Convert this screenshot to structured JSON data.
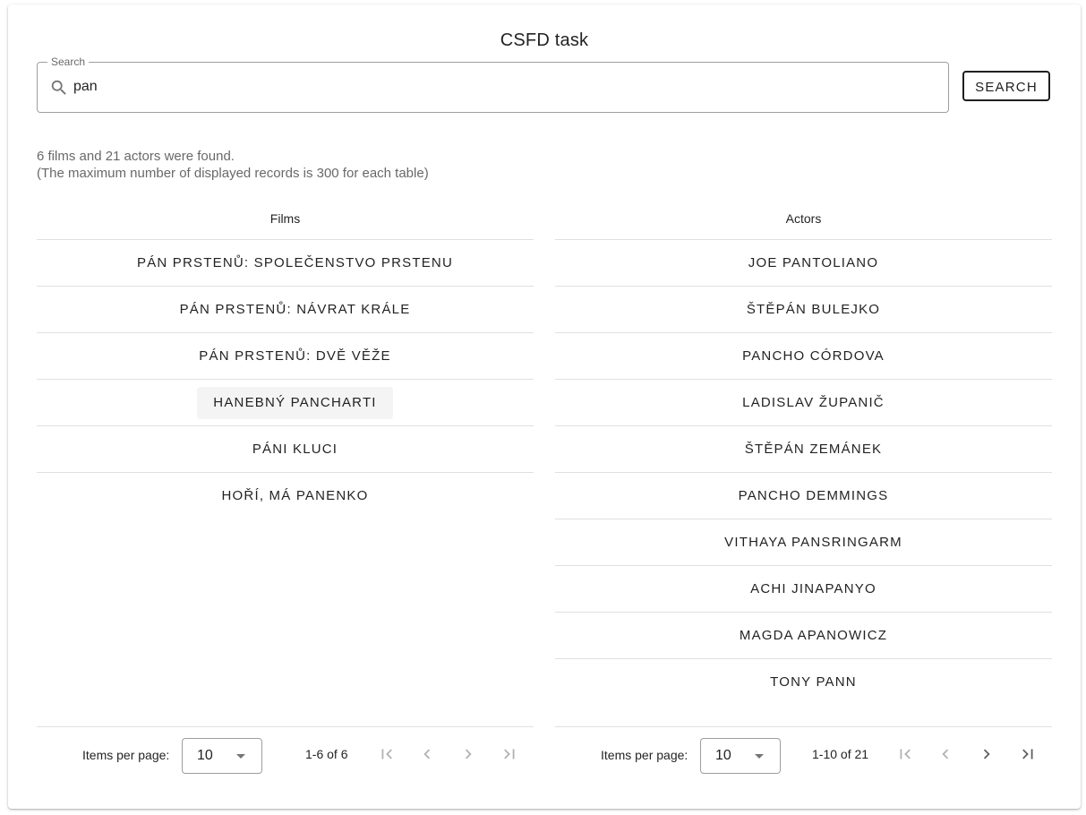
{
  "app": {
    "title": "CSFD task"
  },
  "search": {
    "legend": "Search",
    "value": "pan",
    "button_label": "SEARCH"
  },
  "result_info": {
    "line1": "6 films and 21 actors were found.",
    "line2": "(The maximum number of displayed records is 300 for each table)"
  },
  "films": {
    "header": "Films",
    "rows": [
      "PÁN PRSTENŮ: SPOLEČENSTVO PRSTENU",
      "PÁN PRSTENŮ: NÁVRAT KRÁLE",
      "PÁN PRSTENŮ: DVĚ VĚŽE",
      "HANEBNÝ PANCHARTI",
      "PÁNI KLUCI",
      "HOŘÍ, MÁ PANENKO"
    ],
    "paginator": {
      "items_per_page_label": "Items per page:",
      "page_size": "10",
      "range": "1-6 of 6"
    }
  },
  "actors": {
    "header": "Actors",
    "rows": [
      "JOE PANTOLIANO",
      "ŠTĚPÁN BULEJKO",
      "PANCHO CÓRDOVA",
      "LADISLAV ŽUPANIČ",
      "ŠTĚPÁN ZEMÁNEK",
      "PANCHO DEMMINGS",
      "VITHAYA PANSRINGARM",
      "ACHI JINAPANYO",
      "MAGDA APANOWICZ",
      "TONY PANN"
    ],
    "paginator": {
      "items_per_page_label": "Items per page:",
      "page_size": "10",
      "range": "1-10 of 21"
    }
  },
  "icons": {
    "search": "search-icon",
    "first_page": "first-page-icon",
    "previous_page": "chevron-left-icon",
    "next_page": "chevron-right-icon",
    "last_page": "last-page-icon",
    "dropdown": "caret-down-icon"
  }
}
